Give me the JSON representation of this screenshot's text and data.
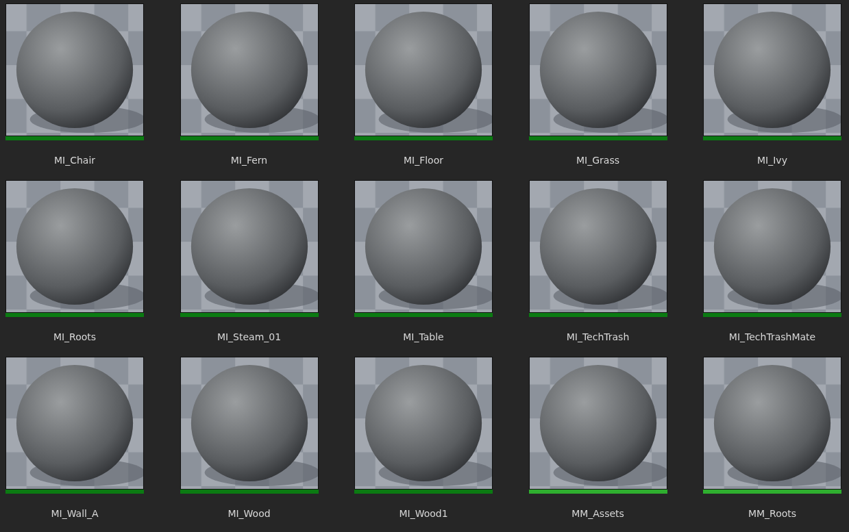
{
  "assets": [
    {
      "name": "MI_Chair",
      "kind": "instance"
    },
    {
      "name": "MI_Fern",
      "kind": "instance"
    },
    {
      "name": "MI_Floor",
      "kind": "instance"
    },
    {
      "name": "MI_Grass",
      "kind": "instance"
    },
    {
      "name": "MI_Ivy",
      "kind": "instance"
    },
    {
      "name": "MI_Roots",
      "kind": "instance"
    },
    {
      "name": "MI_Steam_01",
      "kind": "instance"
    },
    {
      "name": "MI_Table",
      "kind": "instance"
    },
    {
      "name": "MI_TechTrash",
      "kind": "instance"
    },
    {
      "name": "MI_TechTrashMate",
      "kind": "instance"
    },
    {
      "name": "MI_Wall_A",
      "kind": "instance"
    },
    {
      "name": "MI_Wood",
      "kind": "instance"
    },
    {
      "name": "MI_Wood1",
      "kind": "instance"
    },
    {
      "name": "MM_Assets",
      "kind": "material"
    },
    {
      "name": "MM_Roots",
      "kind": "material"
    }
  ]
}
